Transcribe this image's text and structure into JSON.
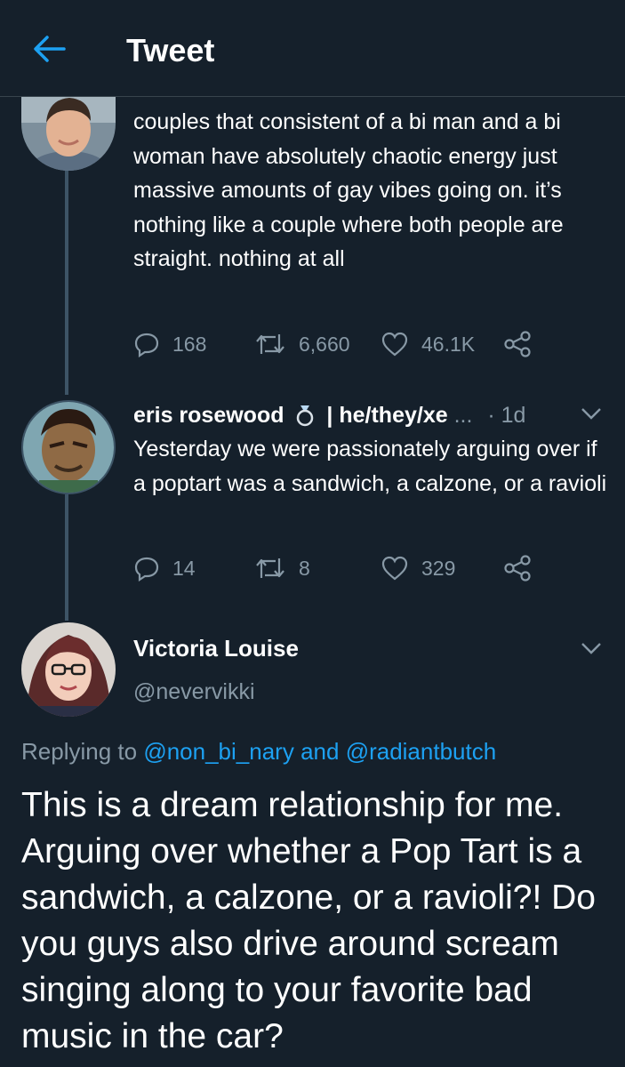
{
  "header": {
    "title": "Tweet"
  },
  "colors": {
    "background": "#15202b",
    "muted": "#8899a6",
    "accent": "#1da1f2",
    "thread_line": "#3d5466"
  },
  "first_tweet": {
    "text": "couples that consistent of a bi man and a bi woman have absolutely chaotic energy just massive amounts of gay vibes going on. it’s nothing like a couple where both people are straight. nothing at all",
    "replies": "168",
    "retweets": "6,660",
    "likes": "46.1K"
  },
  "second_tweet": {
    "name": "eris rosewood",
    "badge_icon": "ring-icon",
    "pronouns": "| he/they/xe",
    "ellipsis": "...",
    "separator": "·",
    "time": "1d",
    "text": "Yesterday we were passionately arguing over if a poptart was a sandwich, a calzone, or a ravioli",
    "replies": "14",
    "retweets": "8",
    "likes": "329"
  },
  "main_tweet": {
    "name": "Victoria Louise",
    "handle": "@nevervikki",
    "replying_prefix": "Replying to",
    "mention1": "@non_bi_nary",
    "and_word": "and",
    "mention2": "@radiantbutch",
    "text": "This is a dream relationship for me. Arguing over whether a Pop Tart is a sandwich, a calzone, or a ravioli?! Do you guys also drive around scream singing along to your favorite bad music in the car?"
  }
}
